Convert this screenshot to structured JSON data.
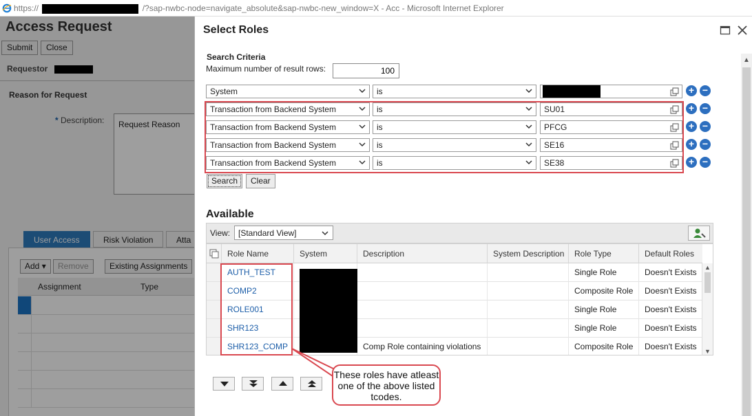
{
  "browser": {
    "url_prefix": "https://",
    "url_rest": "/?sap-nwbc-node=navigate_absolute&sap-nwbc-new_window=X - Acc - Microsoft Internet Explorer"
  },
  "background_page": {
    "title": "Access Request",
    "buttons": [
      "Submit",
      "Close"
    ],
    "requestor_label": "Requestor",
    "reason_heading": "Reason for Request",
    "description_label": "Description:",
    "description_required": "*",
    "description_value": "Request Reason",
    "tabs": [
      "User Access",
      "Risk Violation",
      "Atta"
    ],
    "toolbar": [
      "Add",
      "Remove",
      "Existing Assignments"
    ],
    "columns": [
      "Assignment",
      "Type"
    ]
  },
  "dialog": {
    "title": "Select Roles",
    "search_criteria_label": "Search Criteria",
    "max_rows_label": "Maximum number of result rows:",
    "max_rows_value": "100",
    "criteria": [
      {
        "field": "System",
        "operator": "is",
        "value": ""
      },
      {
        "field": "Transaction from Backend System",
        "operator": "is",
        "value": "SU01"
      },
      {
        "field": "Transaction from Backend System",
        "operator": "is",
        "value": "PFCG"
      },
      {
        "field": "Transaction from Backend System",
        "operator": "is",
        "value": "SE16"
      },
      {
        "field": "Transaction from Backend System",
        "operator": "is",
        "value": "SE38"
      }
    ],
    "search_button": "Search",
    "clear_button": "Clear",
    "available_label": "Available",
    "view_label": "View:",
    "view_value": "[Standard View]",
    "columns": [
      "Role Name",
      "System",
      "Description",
      "System Description",
      "Role Type",
      "Default Roles"
    ],
    "rows": [
      {
        "role": "AUTH_TEST",
        "system": "",
        "description": "",
        "sysdesc": "",
        "type": "Single Role",
        "default": "Doesn't Exists"
      },
      {
        "role": "COMP2",
        "system": "",
        "description": "",
        "sysdesc": "",
        "type": "Composite Role",
        "default": "Doesn't Exists"
      },
      {
        "role": "ROLE001",
        "system": "",
        "description": "",
        "sysdesc": "",
        "type": "Single Role",
        "default": "Doesn't Exists"
      },
      {
        "role": "SHR123",
        "system": "",
        "description": "",
        "sysdesc": "",
        "type": "Single Role",
        "default": "Doesn't Exists"
      },
      {
        "role": "SHR123_COMP",
        "system": "",
        "description": "Comp Role containing violations",
        "sysdesc": "",
        "type": "Composite Role",
        "default": "Doesn't Exists"
      }
    ],
    "callout_text": "These roles have atleast one of the above listed tcodes."
  },
  "colors": {
    "link": "#1b5da8",
    "highlight": "#d9474f",
    "active_tab": "#2e7bbd",
    "round_button": "#2d6fbf"
  },
  "icons": [
    "ie-icon",
    "maximize-icon",
    "close-icon",
    "chevron-down-icon",
    "value-help-icon",
    "add-icon",
    "remove-icon",
    "personalize-icon",
    "move-down-icon",
    "move-bottom-icon",
    "move-up-icon",
    "move-top-icon"
  ]
}
